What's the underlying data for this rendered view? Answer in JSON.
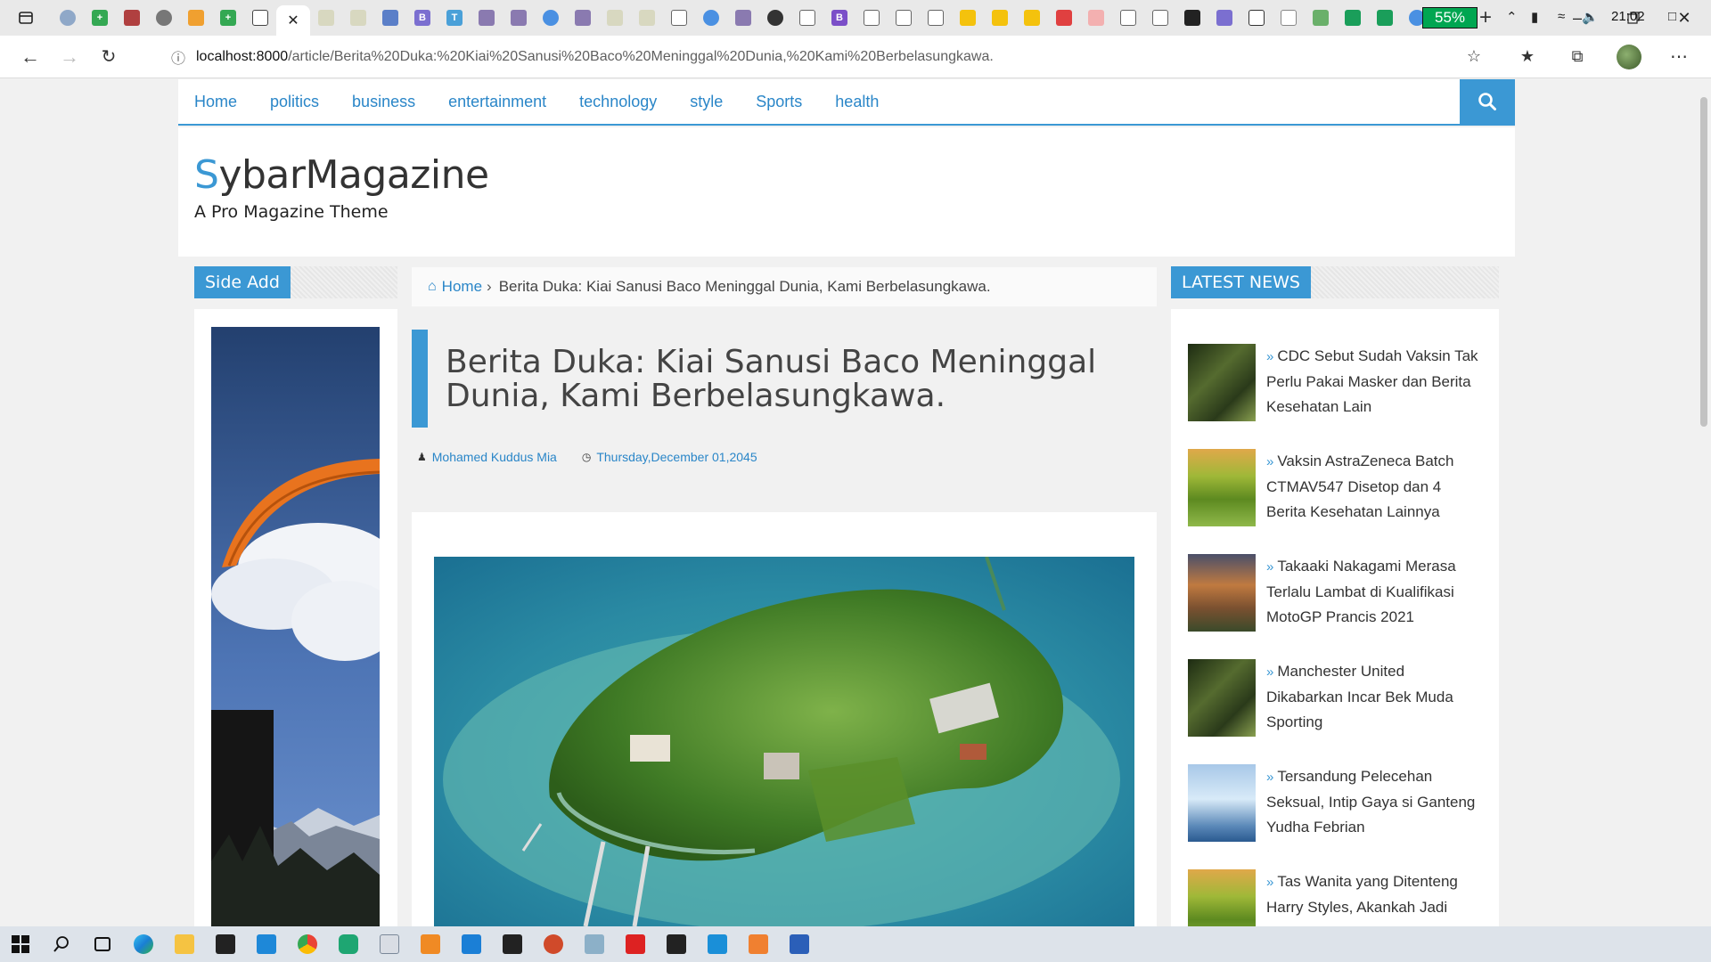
{
  "browser": {
    "url_host": "localhost:8000",
    "url_path": "/article/Berita%20Duka:%20Kiai%20Sanusi%20Baco%20Meninggal%20Dunia,%20Kami%20Berbelasungkawa.",
    "active_tab_close": "✕"
  },
  "menu": {
    "items": [
      "Home",
      "politics",
      "business",
      "entertainment",
      "technology",
      "style",
      "Sports",
      "health"
    ]
  },
  "site": {
    "logo_first": "S",
    "logo_rest": "ybarMagazine",
    "tagline": "A Pro Magazine Theme"
  },
  "sidebar": {
    "heading": "Side Add"
  },
  "breadcrumb": {
    "home": "Home",
    "sep": "›",
    "current": "Berita Duka: Kiai Sanusi Baco Meninggal Dunia, Kami Berbelasungkawa."
  },
  "article": {
    "title": "Berita Duka: Kiai Sanusi Baco Meninggal Dunia, Kami Berbelasungkawa.",
    "author": "Mohamed Kuddus Mia",
    "date": "Thursday,December 01,2045"
  },
  "latest": {
    "heading": "LATEST NEWS",
    "items": [
      {
        "title": "CDC Sebut Sudah Vaksin Tak Perlu Pakai Masker dan Berita Kesehatan Lain",
        "thumb": "leaves"
      },
      {
        "title": "Vaksin AstraZeneca Batch CTMAV547 Disetop dan 4 Berita Kesehatan Lainnya",
        "thumb": "fields"
      },
      {
        "title": "Takaaki Nakagami Merasa Terlalu Lambat di Kualifikasi MotoGP Prancis 2021",
        "thumb": "castle"
      },
      {
        "title": "Manchester United Dikabarkan Incar Bek Muda Sporting",
        "thumb": "leaves"
      },
      {
        "title": "Tersandung Pelecehan Seksual, Intip Gaya si Ganteng Yudha Febrian",
        "thumb": "ice"
      },
      {
        "title": "Tas Wanita yang Ditenteng Harry Styles, Akankah Jadi Tren Buat Pria?",
        "thumb": "fields"
      }
    ]
  },
  "taskbar": {
    "battery": "55%",
    "time": "21:02"
  },
  "colors": {
    "accent": "#3b98d4",
    "link": "#2a86c8"
  }
}
